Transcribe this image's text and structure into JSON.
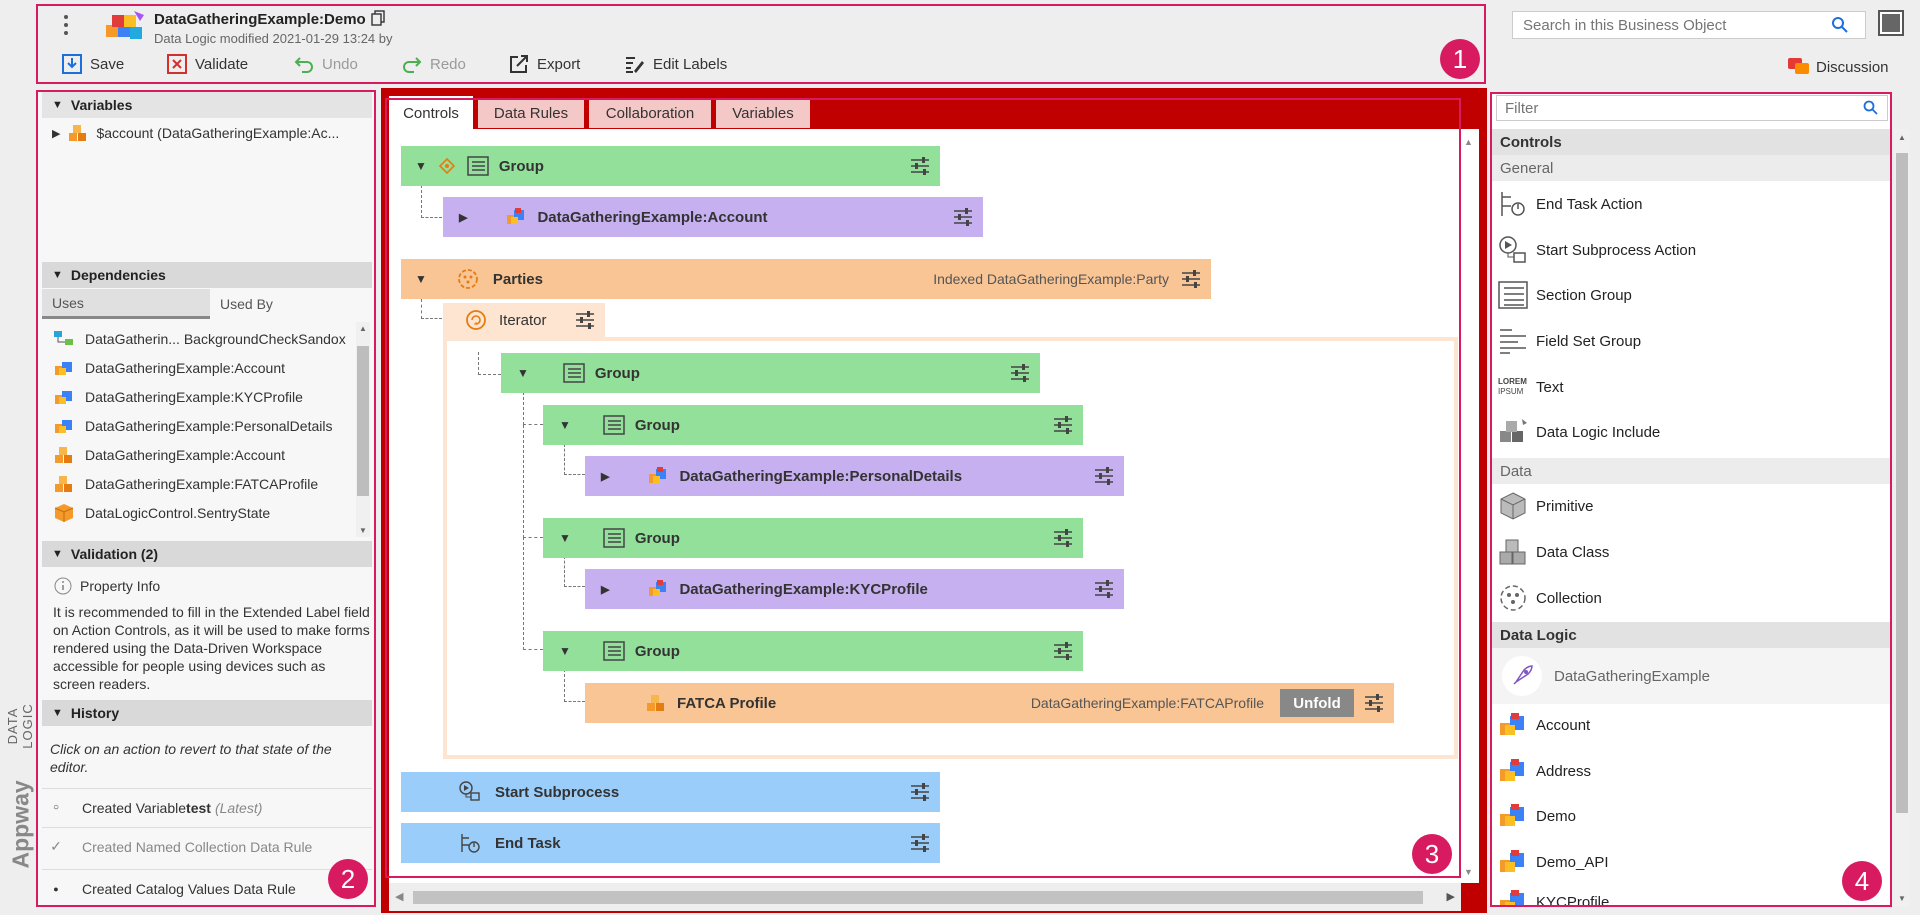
{
  "header": {
    "title": "DataGatheringExample:Demo",
    "subtitle": "Data Logic modified 2021-01-29 13:24 by",
    "toolbar": {
      "save": "Save",
      "validate": "Validate",
      "undo": "Undo",
      "redo": "Redo",
      "export": "Export",
      "edit_labels": "Edit Labels"
    },
    "search_placeholder": "Search in this Business Object",
    "discussion": "Discussion"
  },
  "left": {
    "variables_title": "Variables",
    "variable": "$account (DataGatheringExample:Ac...",
    "dependencies_title": "Dependencies",
    "tab_uses": "Uses",
    "tab_used_by": "Used By",
    "deps": [
      "DataGatherin... BackgroundCheckSandox",
      "DataGatheringExample:Account",
      "DataGatheringExample:KYCProfile",
      "DataGatheringExample:PersonalDetails",
      "DataGatheringExample:Account",
      "DataGatheringExample:FATCAProfile",
      "DataLogicControl.SentryState"
    ],
    "validation_title": "Validation (2)",
    "property_info": "Property Info",
    "validation_text": "It is recommended to fill in the Extended Label field on Action Controls, as it will be used to make forms rendered using the Data-Driven Workspace accessible for people using devices such as screen readers.",
    "history_title": "History",
    "history_hint": "Click on an action to revert to that state of the editor.",
    "history": [
      {
        "pre": "Created Variable ",
        "bold": "test",
        "post": " (Latest)"
      },
      {
        "text": "Created Named Collection Data Rule"
      },
      {
        "text": "Created Catalog Values Data Rule"
      }
    ],
    "vertical_brand": "Appway",
    "vertical_label": "DATA LOGIC"
  },
  "center": {
    "tabs": [
      "Controls",
      "Data Rules",
      "Collaboration",
      "Variables"
    ],
    "nodes": {
      "group1": "Group",
      "account": "DataGatheringExample:Account",
      "parties": "Parties",
      "parties_info": "Indexed DataGatheringExample:Party",
      "iterator": "Iterator",
      "group2": "Group",
      "group3": "Group",
      "personal": "DataGatheringExample:PersonalDetails",
      "group4": "Group",
      "kyc": "DataGatheringExample:KYCProfile",
      "group5": "Group",
      "fatca": "FATCA Profile",
      "fatca_info": "DataGatheringExample:FATCAProfile",
      "unfold": "Unfold",
      "start_subprocess": "Start Subprocess",
      "end_task": "End Task"
    }
  },
  "right": {
    "filter_placeholder": "Filter",
    "controls_title": "Controls",
    "general_title": "General",
    "general": [
      "End Task Action",
      "Start Subprocess Action",
      "Section Group",
      "Field Set Group",
      "Text",
      "Data Logic Include"
    ],
    "lorem_top": "LOREM",
    "lorem_bottom": "IPSUM",
    "data_title": "Data",
    "data": [
      "Primitive",
      "Data Class",
      "Collection"
    ],
    "data_logic_title": "Data Logic",
    "data_logic_main": "DataGatheringExample",
    "data_logic": [
      "Account",
      "Address",
      "Demo",
      "Demo_API",
      "KYCProfile"
    ]
  },
  "annotations": [
    "1",
    "2",
    "3",
    "4"
  ],
  "colors": {
    "accent": "#c00000",
    "marker": "#d81b60",
    "group": "#93e09a",
    "object": "#c6b0f0",
    "iterator": "#f9c595",
    "action": "#9bcdfa"
  }
}
